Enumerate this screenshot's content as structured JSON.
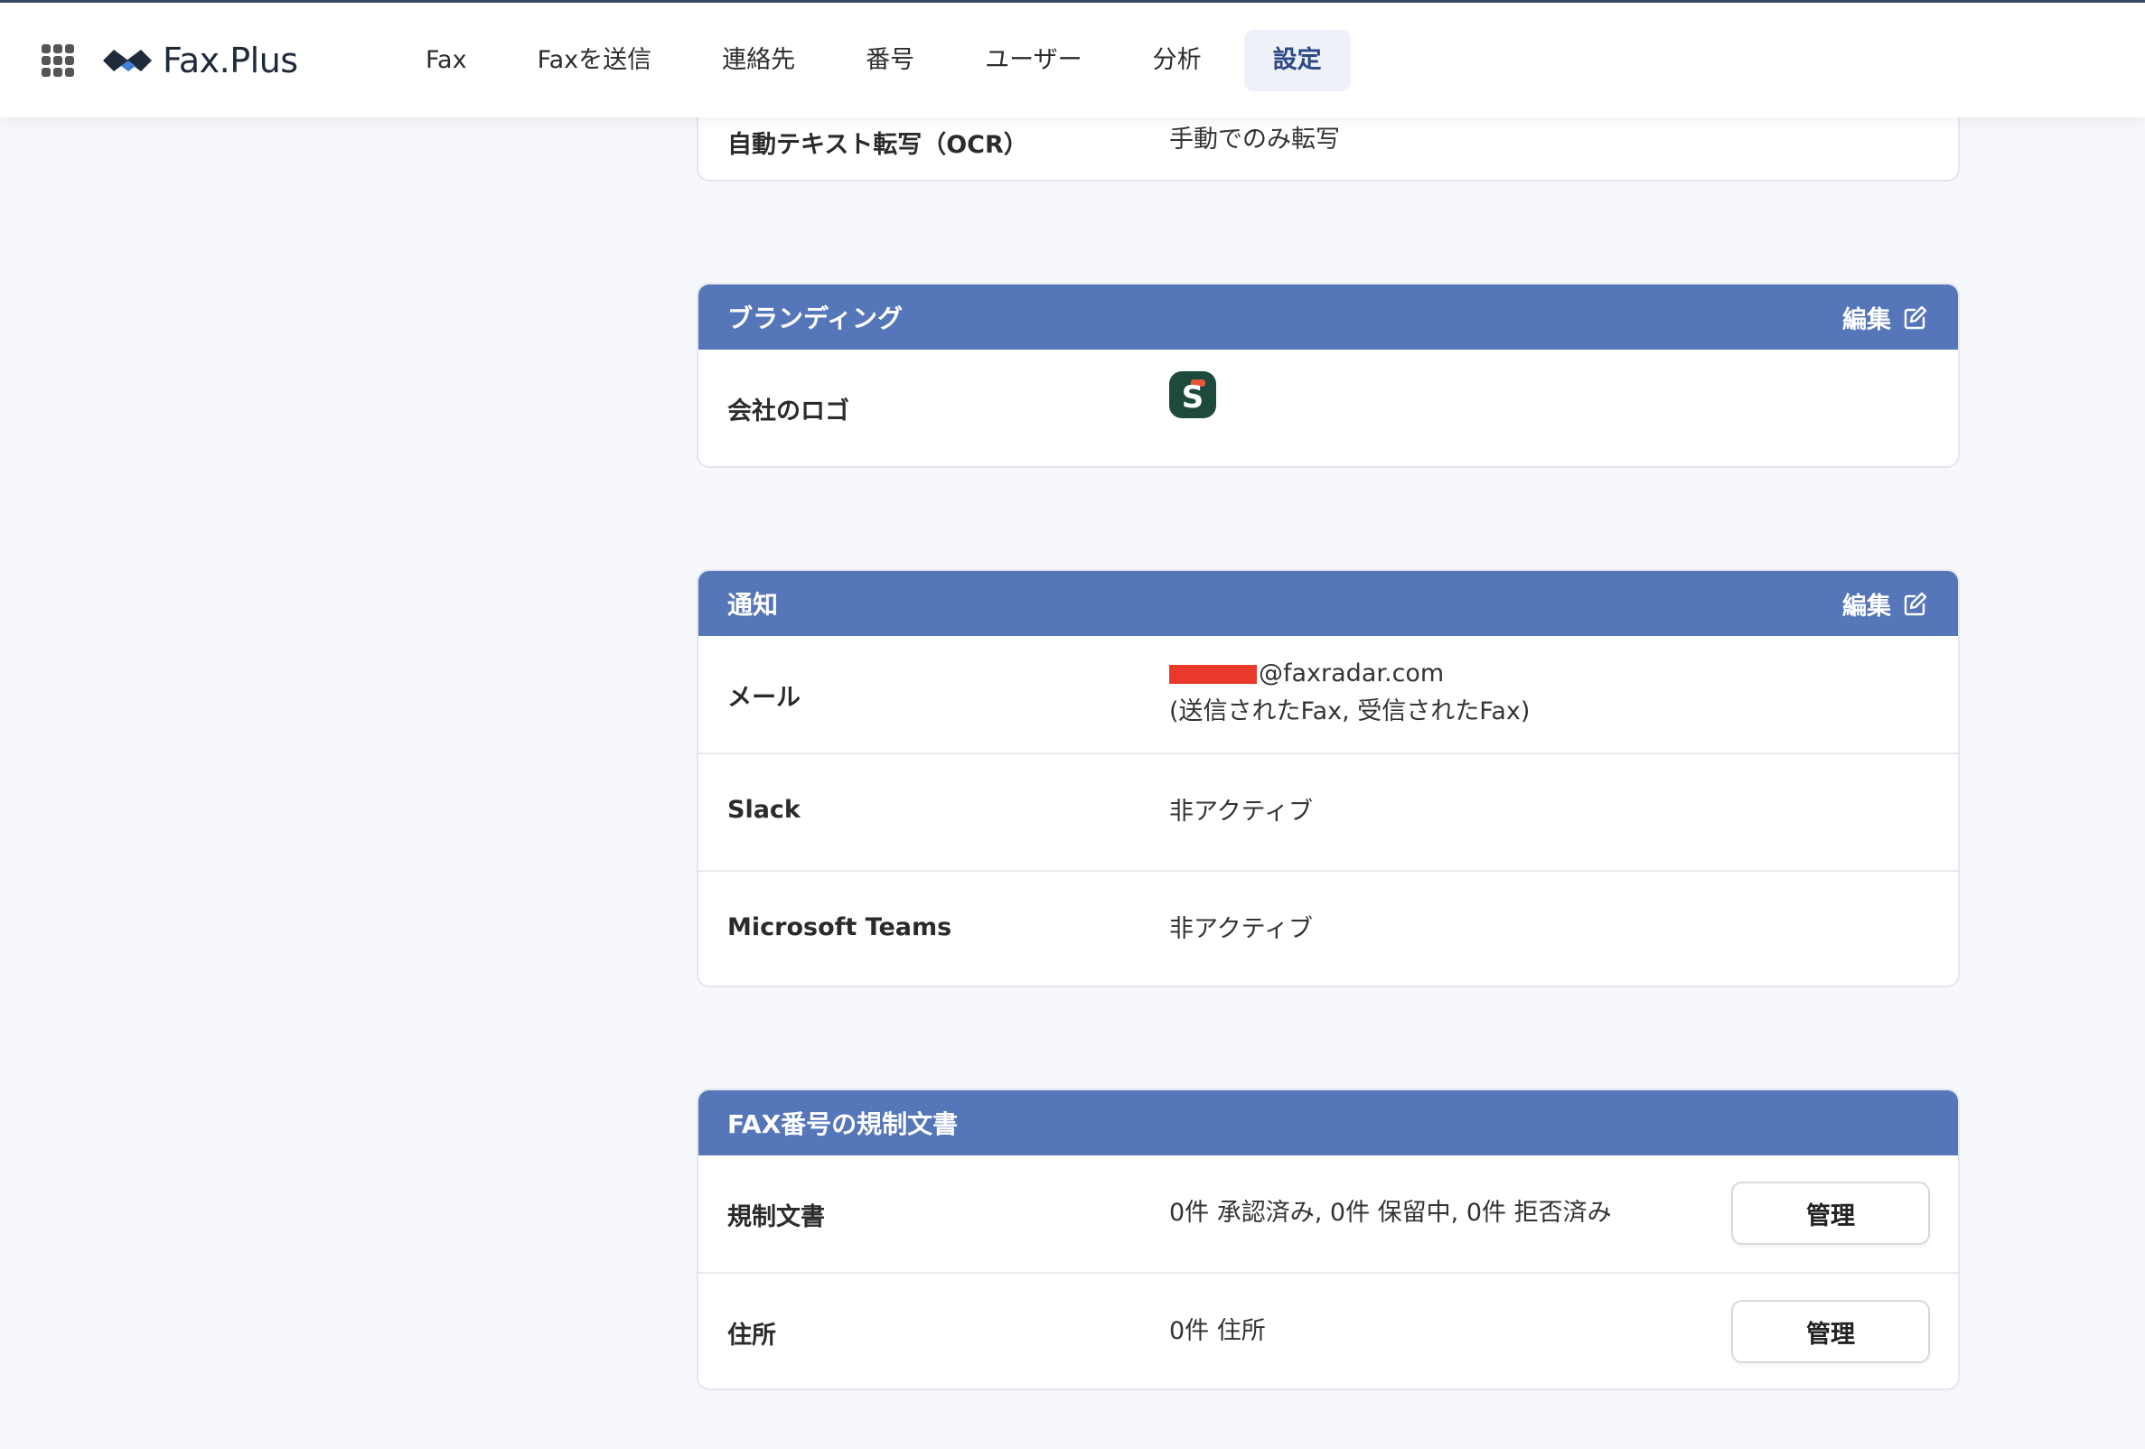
{
  "header": {
    "brand": "Fax.Plus",
    "nav": [
      {
        "label": "Fax"
      },
      {
        "label": "Faxを送信"
      },
      {
        "label": "連絡先"
      },
      {
        "label": "番号"
      },
      {
        "label": "ユーザー"
      },
      {
        "label": "分析"
      },
      {
        "label": "設定",
        "active": true
      }
    ]
  },
  "ocr_card": {
    "label": "自動テキスト転写（OCR）",
    "value": "手動でのみ転写"
  },
  "branding": {
    "title": "ブランディング",
    "edit_label": "編集",
    "rows": [
      {
        "label": "会社のロゴ",
        "logo_letter": "S"
      }
    ]
  },
  "notifications": {
    "title": "通知",
    "edit_label": "編集",
    "email": {
      "label": "メール",
      "address_domain": "@faxradar.com",
      "detail": "(送信されたFax, 受信されたFax)"
    },
    "slack": {
      "label": "Slack",
      "value": "非アクティブ"
    },
    "teams": {
      "label": "Microsoft Teams",
      "value": "非アクティブ"
    }
  },
  "regulatory": {
    "title": "FAX番号の規制文書",
    "documents": {
      "label": "規制文書",
      "value": "0件 承認済み, 0件 保留中, 0件 拒否済み",
      "button": "管理"
    },
    "address": {
      "label": "住所",
      "value": "0件 住所",
      "button": "管理"
    }
  },
  "colors": {
    "card_header": "#5676ba",
    "active_nav": "#2e4a86",
    "redaction": "#e8392a"
  }
}
